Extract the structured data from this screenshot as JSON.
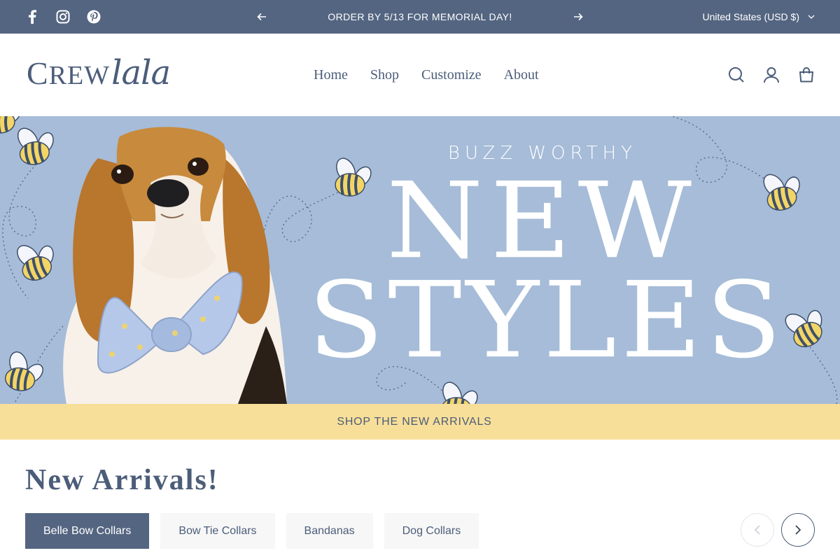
{
  "announcement": {
    "message": "ORDER BY 5/13 FOR MEMORIAL DAY!",
    "country": "United States (USD $)",
    "social": [
      "facebook-icon",
      "instagram-icon",
      "pinterest-icon"
    ]
  },
  "header": {
    "logo": {
      "part1": "C",
      "part2": "REW",
      "part3": "lala"
    },
    "nav": [
      "Home",
      "Shop",
      "Customize",
      "About"
    ],
    "icons": [
      "search-icon",
      "account-icon",
      "cart-icon"
    ]
  },
  "hero": {
    "kicker": "BUZZ WORTHY",
    "line1": "NEW",
    "line2": "STYLES",
    "background": "#a6bcd8"
  },
  "band": {
    "label": "SHOP THE NEW ARRIVALS",
    "background": "#f8df99"
  },
  "arrivals": {
    "title": "New Arrivals!",
    "tabs": [
      "Belle Bow Collars",
      "Bow Tie Collars",
      "Bandanas",
      "Dog Collars"
    ],
    "active_tab": "Belle Bow Collars"
  },
  "colors": {
    "brand": "#546581",
    "text": "#4b5d79",
    "hero": "#a6bcd8",
    "band": "#f8df99"
  }
}
